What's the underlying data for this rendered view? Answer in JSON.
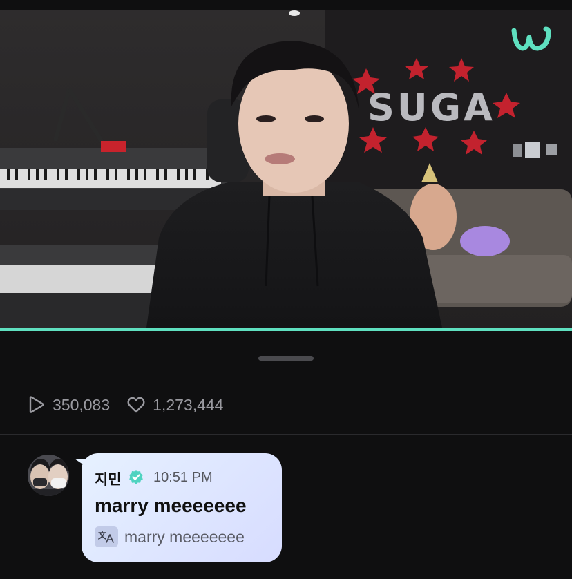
{
  "video": {
    "logo_icon": "weverse-logo-icon",
    "progress_fraction": 1.0,
    "accent_color": "#5fe0c0"
  },
  "stats": {
    "plays": "350,083",
    "likes": "1,273,444"
  },
  "comment": {
    "author": "지민",
    "time": "10:51 PM",
    "message": "marry meeeeeee",
    "translation": "marry meeeeeee",
    "verified_icon": "verified-badge-icon",
    "translate_icon": "translate-icon"
  }
}
